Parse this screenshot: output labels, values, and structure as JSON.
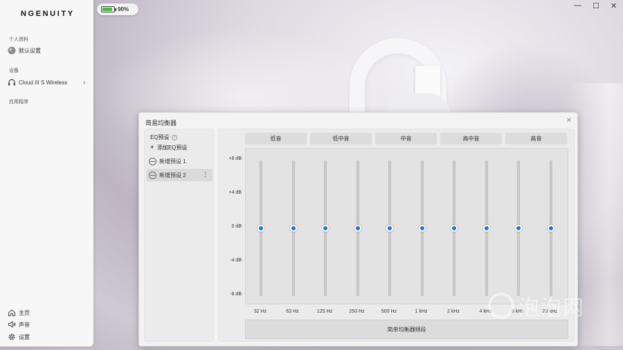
{
  "app": {
    "logo": "NGENUITY"
  },
  "battery": {
    "percent_label": "90%",
    "level": 0.9
  },
  "window_controls": {
    "minimize": "—",
    "maximize": "☐",
    "close": "✕"
  },
  "sidebar": {
    "profile_section": "个人资料",
    "profile_item": "默认设置",
    "devices_section": "设备",
    "device_item": "Cloud III S Wireless",
    "apps_section": "应用程序",
    "bottom": {
      "home": "主页",
      "sound": "声音",
      "settings": "设置"
    }
  },
  "dialog": {
    "title": "简易均衡器",
    "close": "✕",
    "presets": {
      "title": "EQ预设",
      "info": "?",
      "add_label": "添加EQ预设",
      "add_icon": "+",
      "items": [
        {
          "label": "新增预设 1",
          "selected": false
        },
        {
          "label": "新增预设 2",
          "selected": true
        }
      ],
      "more": "⋮"
    },
    "eq": {
      "band_headers": [
        "低音",
        "低中音",
        "中音",
        "高中音",
        "高音"
      ],
      "db_labels": [
        "+8 dB",
        "+4 dB",
        "0 dB",
        "-4 dB",
        "-8 dB"
      ],
      "frequencies": [
        "32 Hz",
        "63 Hz",
        "125 Hz",
        "250 Hz",
        "500 Hz",
        "1 kHz",
        "2 kHz",
        "4 kHz",
        "8 kHz",
        "20 kHz"
      ],
      "gains_db": [
        0,
        0,
        0,
        0,
        0,
        0,
        0,
        0,
        0,
        0
      ],
      "range_db": [
        -8,
        8
      ],
      "accent_color": "#1e74c9",
      "bottom_button": "简单均衡器频段"
    }
  },
  "watermark": {
    "text": "泡泡网"
  }
}
